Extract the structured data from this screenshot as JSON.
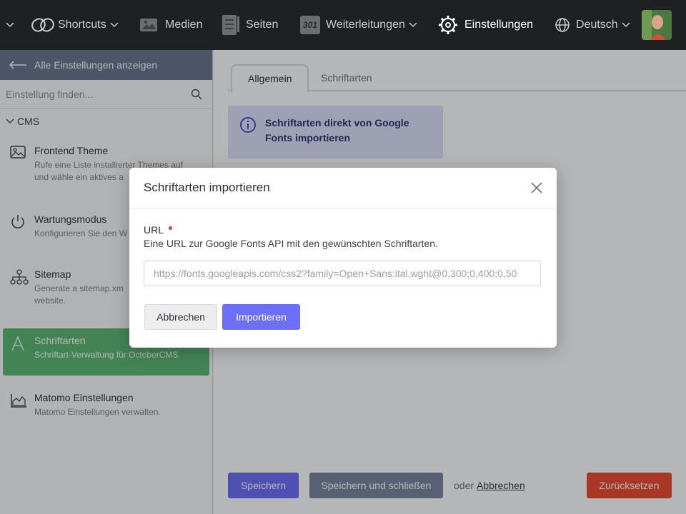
{
  "topbar": {
    "shortcuts": "Shortcuts",
    "media": "Medien",
    "pages": "Seiten",
    "redirects": "Weiterleitungen",
    "redirects_badge": "301",
    "settings": "Einstellungen",
    "language": "Deutsch"
  },
  "sidebar": {
    "back_label": "Alle Einstellungen anzeigen",
    "search_placeholder": "Einstellung finden...",
    "group": "CMS",
    "items": [
      {
        "title": "Frontend Theme",
        "desc": "Rufe eine Liste installierter Themes auf und wähle ein aktives a",
        "icon": "image-icon"
      },
      {
        "title": "Wartungsmodus",
        "desc": "Konfigurieren Sie den W",
        "icon": "power-icon"
      },
      {
        "title": "Sitemap",
        "desc": "Generate a sitemap.xm website.",
        "icon": "sitemap-icon"
      },
      {
        "title": "Schriftarten",
        "desc": "Schriftart-Verwaltung für OctoberCMS",
        "icon": "font-icon"
      },
      {
        "title": "Matomo Einstellungen",
        "desc": "Matomo Einstellungen verwalten.",
        "icon": "area-chart-icon"
      }
    ]
  },
  "main": {
    "tabs": [
      "Allgemein",
      "Schriftarten"
    ],
    "info_text": "Schriftarten direkt von Google Fonts importieren",
    "save": "Speichern",
    "save_close": "Speichern und schließen",
    "or": "oder",
    "cancel": "Abbrechen",
    "reset": "Zurücksetzen"
  },
  "modal": {
    "title": "Schriftarten importieren",
    "field_label": "URL",
    "field_help": "Eine URL zur Google Fonts API mit den gewünschten Schriftarten.",
    "url_placeholder": "https://fonts.googleapis.com/css2?family=Open+Sans:ital,wght@0,300;0,400;0,50",
    "cancel": "Abbrechen",
    "import": "Importieren"
  },
  "colors": {
    "accent": "#6c6ff8",
    "active_item": "#5cb873",
    "danger": "#ec4b2e",
    "topbar": "#1f2022"
  }
}
